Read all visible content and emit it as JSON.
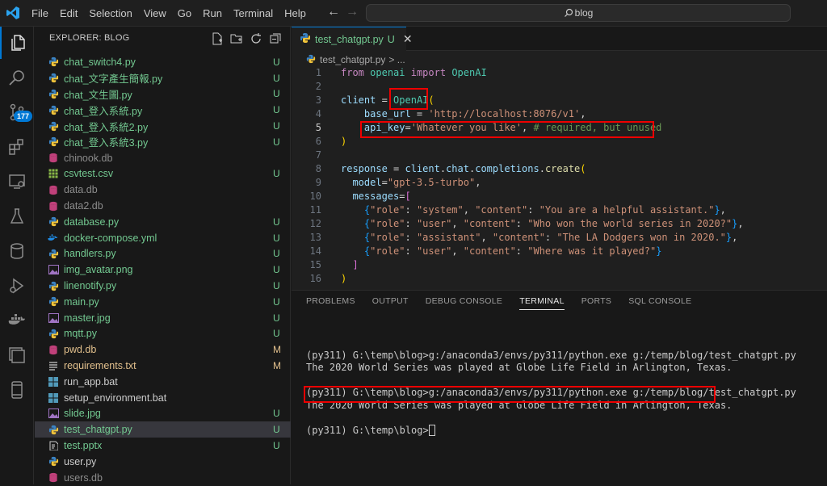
{
  "menu": [
    "File",
    "Edit",
    "Selection",
    "View",
    "Go",
    "Run",
    "Terminal",
    "Help"
  ],
  "search": {
    "text": "blog"
  },
  "activity": {
    "badge": "177"
  },
  "explorer": {
    "title": "EXPLORER: BLOG",
    "files": [
      {
        "name": "chat_switch4.py",
        "icon": "python",
        "color": "#73c991",
        "badge": "U",
        "badge_color": "#73c991"
      },
      {
        "name": "chat_文字產生簡報.py",
        "icon": "python",
        "color": "#73c991",
        "badge": "U",
        "badge_color": "#73c991"
      },
      {
        "name": "chat_文生圖.py",
        "icon": "python",
        "color": "#73c991",
        "badge": "U",
        "badge_color": "#73c991"
      },
      {
        "name": "chat_登入系統.py",
        "icon": "python",
        "color": "#73c991",
        "badge": "U",
        "badge_color": "#73c991"
      },
      {
        "name": "chat_登入系統2.py",
        "icon": "python",
        "color": "#73c991",
        "badge": "U",
        "badge_color": "#73c991"
      },
      {
        "name": "chat_登入系統3.py",
        "icon": "python",
        "color": "#73c991",
        "badge": "U",
        "badge_color": "#73c991"
      },
      {
        "name": "chinook.db",
        "icon": "db",
        "color": "#8b8b8b",
        "badge": "",
        "badge_color": ""
      },
      {
        "name": "csvtest.csv",
        "icon": "csv",
        "color": "#73c991",
        "badge": "U",
        "badge_color": "#73c991"
      },
      {
        "name": "data.db",
        "icon": "db",
        "color": "#8b8b8b",
        "badge": "",
        "badge_color": ""
      },
      {
        "name": "data2.db",
        "icon": "db",
        "color": "#8b8b8b",
        "badge": "",
        "badge_color": ""
      },
      {
        "name": "database.py",
        "icon": "python",
        "color": "#73c991",
        "badge": "U",
        "badge_color": "#73c991"
      },
      {
        "name": "docker-compose.yml",
        "icon": "docker",
        "color": "#73c991",
        "badge": "U",
        "badge_color": "#73c991"
      },
      {
        "name": "handlers.py",
        "icon": "python",
        "color": "#73c991",
        "badge": "U",
        "badge_color": "#73c991"
      },
      {
        "name": "img_avatar.png",
        "icon": "image",
        "color": "#73c991",
        "badge": "U",
        "badge_color": "#73c991"
      },
      {
        "name": "linenotify.py",
        "icon": "python",
        "color": "#73c991",
        "badge": "U",
        "badge_color": "#73c991"
      },
      {
        "name": "main.py",
        "icon": "python",
        "color": "#73c991",
        "badge": "U",
        "badge_color": "#73c991"
      },
      {
        "name": "master.jpg",
        "icon": "image",
        "color": "#73c991",
        "badge": "U",
        "badge_color": "#73c991"
      },
      {
        "name": "mqtt.py",
        "icon": "python",
        "color": "#73c991",
        "badge": "U",
        "badge_color": "#73c991"
      },
      {
        "name": "pwd.db",
        "icon": "db",
        "color": "#e2c08d",
        "badge": "M",
        "badge_color": "#e2c08d"
      },
      {
        "name": "requirements.txt",
        "icon": "text",
        "color": "#e2c08d",
        "badge": "M",
        "badge_color": "#e2c08d"
      },
      {
        "name": "run_app.bat",
        "icon": "windows",
        "color": "#cccccc",
        "badge": "",
        "badge_color": ""
      },
      {
        "name": "setup_environment.bat",
        "icon": "windows",
        "color": "#cccccc",
        "badge": "",
        "badge_color": ""
      },
      {
        "name": "slide.jpg",
        "icon": "image",
        "color": "#73c991",
        "badge": "U",
        "badge_color": "#73c991"
      },
      {
        "name": "test_chatgpt.py",
        "icon": "python",
        "color": "#73c991",
        "badge": "U",
        "badge_color": "#73c991",
        "selected": true
      },
      {
        "name": "test.pptx",
        "icon": "pptx",
        "color": "#73c991",
        "badge": "U",
        "badge_color": "#73c991"
      },
      {
        "name": "user.py",
        "icon": "python",
        "color": "#cccccc",
        "badge": "",
        "badge_color": ""
      },
      {
        "name": "users.db",
        "icon": "db",
        "color": "#8b8b8b",
        "badge": "",
        "badge_color": ""
      }
    ]
  },
  "editor": {
    "tab": {
      "name": "test_chatgpt.py",
      "status": "U"
    },
    "breadcrumb": {
      "file": "test_chatgpt.py",
      "rest": "> ..."
    },
    "lines": [
      {
        "n": "1",
        "tokens": [
          [
            "kw",
            "from"
          ],
          [
            "op",
            " "
          ],
          [
            "cls",
            "openai"
          ],
          [
            "op",
            " "
          ],
          [
            "kw",
            "import"
          ],
          [
            "op",
            " "
          ],
          [
            "cls",
            "OpenAI"
          ]
        ]
      },
      {
        "n": "2",
        "tokens": []
      },
      {
        "n": "3",
        "tokens": [
          [
            "id",
            "client"
          ],
          [
            "op",
            " = "
          ],
          [
            "cls",
            "OpenAI"
          ],
          [
            "br1",
            "("
          ]
        ]
      },
      {
        "n": "4",
        "tokens": [
          [
            "op",
            "    "
          ],
          [
            "id",
            "base_url"
          ],
          [
            "op",
            " = "
          ],
          [
            "str",
            "'http://localhost:8076/v1'"
          ],
          [
            "op",
            ","
          ]
        ]
      },
      {
        "n": "5",
        "cur": true,
        "tokens": [
          [
            "op",
            "    "
          ],
          [
            "id",
            "api_key"
          ],
          [
            "op",
            "="
          ],
          [
            "str",
            "'Whatever you like'"
          ],
          [
            "op",
            ", "
          ],
          [
            "cm",
            "# required, but unused"
          ]
        ]
      },
      {
        "n": "6",
        "tokens": [
          [
            "br1",
            ")"
          ]
        ]
      },
      {
        "n": "7",
        "tokens": []
      },
      {
        "n": "8",
        "tokens": [
          [
            "id",
            "response"
          ],
          [
            "op",
            " = "
          ],
          [
            "id",
            "client"
          ],
          [
            "op",
            "."
          ],
          [
            "id",
            "chat"
          ],
          [
            "op",
            "."
          ],
          [
            "id",
            "completions"
          ],
          [
            "op",
            "."
          ],
          [
            "fn",
            "create"
          ],
          [
            "br1",
            "("
          ]
        ]
      },
      {
        "n": "9",
        "tokens": [
          [
            "op",
            "  "
          ],
          [
            "id",
            "model"
          ],
          [
            "op",
            "="
          ],
          [
            "str",
            "\"gpt-3.5-turbo\""
          ],
          [
            "op",
            ","
          ]
        ]
      },
      {
        "n": "10",
        "tokens": [
          [
            "op",
            "  "
          ],
          [
            "id",
            "messages"
          ],
          [
            "op",
            "="
          ],
          [
            "br2",
            "["
          ]
        ]
      },
      {
        "n": "11",
        "tokens": [
          [
            "op",
            "    "
          ],
          [
            "br3",
            "{"
          ],
          [
            "str",
            "\"role\""
          ],
          [
            "op",
            ": "
          ],
          [
            "str",
            "\"system\""
          ],
          [
            "op",
            ", "
          ],
          [
            "str",
            "\"content\""
          ],
          [
            "op",
            ": "
          ],
          [
            "str",
            "\"You are a helpful assistant.\""
          ],
          [
            "br3",
            "}"
          ],
          [
            "op",
            ","
          ]
        ]
      },
      {
        "n": "12",
        "tokens": [
          [
            "op",
            "    "
          ],
          [
            "br3",
            "{"
          ],
          [
            "str",
            "\"role\""
          ],
          [
            "op",
            ": "
          ],
          [
            "str",
            "\"user\""
          ],
          [
            "op",
            ", "
          ],
          [
            "str",
            "\"content\""
          ],
          [
            "op",
            ": "
          ],
          [
            "str",
            "\"Who won the world series in 2020?\""
          ],
          [
            "br3",
            "}"
          ],
          [
            "op",
            ","
          ]
        ]
      },
      {
        "n": "13",
        "tokens": [
          [
            "op",
            "    "
          ],
          [
            "br3",
            "{"
          ],
          [
            "str",
            "\"role\""
          ],
          [
            "op",
            ": "
          ],
          [
            "str",
            "\"assistant\""
          ],
          [
            "op",
            ", "
          ],
          [
            "str",
            "\"content\""
          ],
          [
            "op",
            ": "
          ],
          [
            "str",
            "\"The LA Dodgers won in 2020.\""
          ],
          [
            "br3",
            "}"
          ],
          [
            "op",
            ","
          ]
        ]
      },
      {
        "n": "14",
        "tokens": [
          [
            "op",
            "    "
          ],
          [
            "br3",
            "{"
          ],
          [
            "str",
            "\"role\""
          ],
          [
            "op",
            ": "
          ],
          [
            "str",
            "\"user\""
          ],
          [
            "op",
            ", "
          ],
          [
            "str",
            "\"content\""
          ],
          [
            "op",
            ": "
          ],
          [
            "str",
            "\"Where was it played?\""
          ],
          [
            "br3",
            "}"
          ]
        ]
      },
      {
        "n": "15",
        "tokens": [
          [
            "op",
            "  "
          ],
          [
            "br2",
            "]"
          ]
        ]
      },
      {
        "n": "16",
        "tokens": [
          [
            "br1",
            ")"
          ]
        ]
      }
    ]
  },
  "panel": {
    "tabs": [
      "PROBLEMS",
      "OUTPUT",
      "DEBUG CONSOLE",
      "TERMINAL",
      "PORTS",
      "SQL CONSOLE"
    ],
    "active_tab": "TERMINAL",
    "terminal": [
      "",
      "(py311) G:\\temp\\blog>g:/anaconda3/envs/py311/python.exe g:/temp/blog/test_chatgpt.py",
      "The 2020 World Series was played at Globe Life Field in Arlington, Texas.",
      "",
      "(py311) G:\\temp\\blog>g:/anaconda3/envs/py311/python.exe g:/temp/blog/test_chatgpt.py",
      "The 2020 World Series was played at Globe Life Field in Arlington, Texas.",
      "",
      "(py311) G:\\temp\\blog>"
    ]
  }
}
